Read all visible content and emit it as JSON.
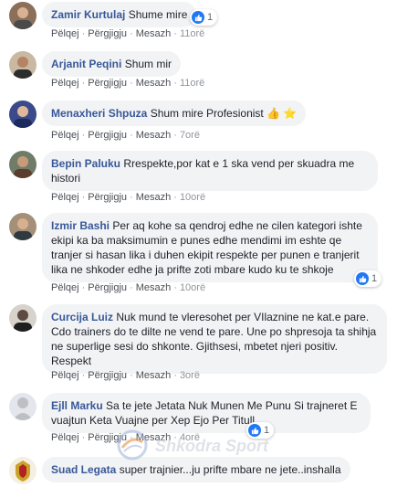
{
  "actions": {
    "like": "Pëlqej",
    "reply": "Përgjigju",
    "message": "Mesazh"
  },
  "comments": [
    {
      "author": "Zamir Kurtulaj",
      "text": "Shume mire",
      "time": "11orë",
      "reactions": "1"
    },
    {
      "author": "Arjanit Peqini",
      "text": "Shum mir",
      "time": "11orë"
    },
    {
      "author": "Menaxheri Shpuza",
      "text": "Shum mire Profesionist",
      "emojis": "👍 ⭐",
      "time": "7orë"
    },
    {
      "author": "Bepin Paluku",
      "text": "Rrespekte,por kat e 1 ska vend per skuadra me histori",
      "time": "10orë"
    },
    {
      "author": "Izmir Bashi",
      "text": "Per aq kohe sa qendroj edhe ne cilen kategori ishte ekipi ka ba maksimumin e punes edhe mendimi im eshte qe tranjer si hasan lika i duhen ekipit respekte per punen e tranjerit lika ne shkoder edhe ja prifte zoti mbare kudo ku te shkoje",
      "time": "10orë",
      "reactions": "1"
    },
    {
      "author": "Curcija Luiz",
      "text": "Nuk mund te vleresohet per VIlaznine ne kat.e pare. Cdo trainers do te dilte ne vend te pare. Une po shpresoja ta shihja ne superlige sesi do shkonte. Gjithsesi, mbetet njeri positiv. Respekt",
      "time": "3orë"
    },
    {
      "author": "Ejll Marku",
      "text": "Sa te jete Jetata Nuk Munen Me Punu Si trajneret E vuajtun Keta Vuajne per Xep Ejo Per Titull",
      "time": "4orë",
      "reactions": "1"
    },
    {
      "author": "Suad Legata",
      "text": "super trajnier...ju prifte mbare ne jete..inshalla",
      "time": ""
    }
  ],
  "watermark": {
    "text": "Shkodra Sport",
    "logo_name": "shkodra-sport-logo"
  },
  "colors": {
    "author": "#385898",
    "bubble": "#f2f3f5",
    "like": "#2078f4",
    "meta": "#90949c"
  }
}
